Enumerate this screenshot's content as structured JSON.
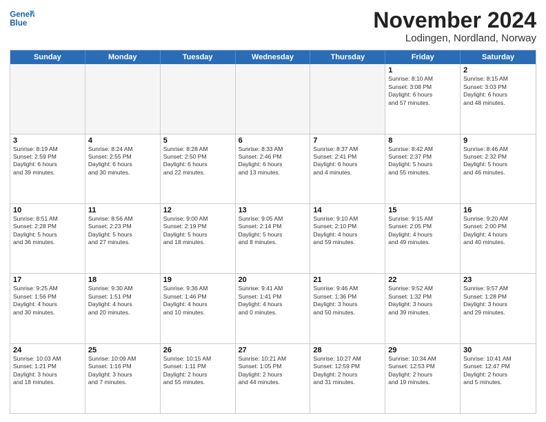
{
  "header": {
    "title": "November 2024",
    "location": "Lodingen, Nordland, Norway",
    "logo_line1": "General",
    "logo_line2": "Blue"
  },
  "days_of_week": [
    "Sunday",
    "Monday",
    "Tuesday",
    "Wednesday",
    "Thursday",
    "Friday",
    "Saturday"
  ],
  "rows": [
    [
      {
        "day": "",
        "text": ""
      },
      {
        "day": "",
        "text": ""
      },
      {
        "day": "",
        "text": ""
      },
      {
        "day": "",
        "text": ""
      },
      {
        "day": "",
        "text": ""
      },
      {
        "day": "1",
        "text": "Sunrise: 8:10 AM\nSunset: 3:08 PM\nDaylight: 6 hours\nand 57 minutes."
      },
      {
        "day": "2",
        "text": "Sunrise: 8:15 AM\nSunset: 3:03 PM\nDaylight: 6 hours\nand 48 minutes."
      }
    ],
    [
      {
        "day": "3",
        "text": "Sunrise: 8:19 AM\nSunset: 2:59 PM\nDaylight: 6 hours\nand 39 minutes."
      },
      {
        "day": "4",
        "text": "Sunrise: 8:24 AM\nSunset: 2:55 PM\nDaylight: 6 hours\nand 30 minutes."
      },
      {
        "day": "5",
        "text": "Sunrise: 8:28 AM\nSunset: 2:50 PM\nDaylight: 6 hours\nand 22 minutes."
      },
      {
        "day": "6",
        "text": "Sunrise: 8:33 AM\nSunset: 2:46 PM\nDaylight: 6 hours\nand 13 minutes."
      },
      {
        "day": "7",
        "text": "Sunrise: 8:37 AM\nSunset: 2:41 PM\nDaylight: 6 hours\nand 4 minutes."
      },
      {
        "day": "8",
        "text": "Sunrise: 8:42 AM\nSunset: 2:37 PM\nDaylight: 5 hours\nand 55 minutes."
      },
      {
        "day": "9",
        "text": "Sunrise: 8:46 AM\nSunset: 2:32 PM\nDaylight: 5 hours\nand 46 minutes."
      }
    ],
    [
      {
        "day": "10",
        "text": "Sunrise: 8:51 AM\nSunset: 2:28 PM\nDaylight: 5 hours\nand 36 minutes."
      },
      {
        "day": "11",
        "text": "Sunrise: 8:56 AM\nSunset: 2:23 PM\nDaylight: 5 hours\nand 27 minutes."
      },
      {
        "day": "12",
        "text": "Sunrise: 9:00 AM\nSunset: 2:19 PM\nDaylight: 5 hours\nand 18 minutes."
      },
      {
        "day": "13",
        "text": "Sunrise: 9:05 AM\nSunset: 2:14 PM\nDaylight: 5 hours\nand 8 minutes."
      },
      {
        "day": "14",
        "text": "Sunrise: 9:10 AM\nSunset: 2:10 PM\nDaylight: 4 hours\nand 59 minutes."
      },
      {
        "day": "15",
        "text": "Sunrise: 9:15 AM\nSunset: 2:05 PM\nDaylight: 4 hours\nand 49 minutes."
      },
      {
        "day": "16",
        "text": "Sunrise: 9:20 AM\nSunset: 2:00 PM\nDaylight: 4 hours\nand 40 minutes."
      }
    ],
    [
      {
        "day": "17",
        "text": "Sunrise: 9:25 AM\nSunset: 1:56 PM\nDaylight: 4 hours\nand 30 minutes."
      },
      {
        "day": "18",
        "text": "Sunrise: 9:30 AM\nSunset: 1:51 PM\nDaylight: 4 hours\nand 20 minutes."
      },
      {
        "day": "19",
        "text": "Sunrise: 9:36 AM\nSunset: 1:46 PM\nDaylight: 4 hours\nand 10 minutes."
      },
      {
        "day": "20",
        "text": "Sunrise: 9:41 AM\nSunset: 1:41 PM\nDaylight: 4 hours\nand 0 minutes."
      },
      {
        "day": "21",
        "text": "Sunrise: 9:46 AM\nSunset: 1:36 PM\nDaylight: 3 hours\nand 50 minutes."
      },
      {
        "day": "22",
        "text": "Sunrise: 9:52 AM\nSunset: 1:32 PM\nDaylight: 3 hours\nand 39 minutes."
      },
      {
        "day": "23",
        "text": "Sunrise: 9:57 AM\nSunset: 1:28 PM\nDaylight: 3 hours\nand 29 minutes."
      }
    ],
    [
      {
        "day": "24",
        "text": "Sunrise: 10:03 AM\nSunset: 1:21 PM\nDaylight: 3 hours\nand 18 minutes."
      },
      {
        "day": "25",
        "text": "Sunrise: 10:09 AM\nSunset: 1:16 PM\nDaylight: 3 hours\nand 7 minutes."
      },
      {
        "day": "26",
        "text": "Sunrise: 10:15 AM\nSunset: 1:11 PM\nDaylight: 2 hours\nand 55 minutes."
      },
      {
        "day": "27",
        "text": "Sunrise: 10:21 AM\nSunset: 1:05 PM\nDaylight: 2 hours\nand 44 minutes."
      },
      {
        "day": "28",
        "text": "Sunrise: 10:27 AM\nSunset: 12:59 PM\nDaylight: 2 hours\nand 31 minutes."
      },
      {
        "day": "29",
        "text": "Sunrise: 10:34 AM\nSunset: 12:53 PM\nDaylight: 2 hours\nand 19 minutes."
      },
      {
        "day": "30",
        "text": "Sunrise: 10:41 AM\nSunset: 12:47 PM\nDaylight: 2 hours\nand 5 minutes."
      }
    ]
  ]
}
